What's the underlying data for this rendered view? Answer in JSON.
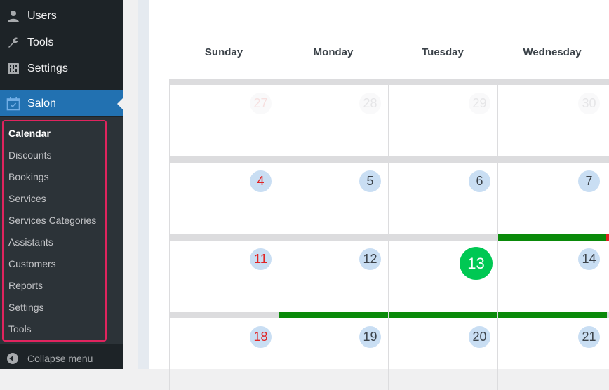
{
  "sidebar": {
    "top_items": [
      {
        "label": "Users",
        "icon": "user-icon"
      },
      {
        "label": "Tools",
        "icon": "wrench-icon"
      },
      {
        "label": "Settings",
        "icon": "settings-sliders-icon"
      }
    ],
    "active_item": {
      "label": "Salon",
      "icon": "calendar-icon"
    },
    "submenu": [
      {
        "label": "Calendar",
        "current": true
      },
      {
        "label": "Discounts"
      },
      {
        "label": "Bookings"
      },
      {
        "label": "Services"
      },
      {
        "label": "Services Categories"
      },
      {
        "label": "Assistants"
      },
      {
        "label": "Customers"
      },
      {
        "label": "Reports"
      },
      {
        "label": "Settings"
      },
      {
        "label": "Tools"
      }
    ],
    "collapse_label": "Collapse menu"
  },
  "calendar": {
    "weekdays": [
      "Sunday",
      "Monday",
      "Tuesday",
      "Wednesday"
    ],
    "weeks": [
      {
        "days": [
          "27",
          "28",
          "29",
          "30"
        ],
        "other_month": true,
        "green_bars": [
          false,
          false,
          false,
          false
        ]
      },
      {
        "days": [
          "4",
          "5",
          "6",
          "7"
        ],
        "other_month": false,
        "green_bars": [
          false,
          false,
          false,
          false
        ]
      },
      {
        "days": [
          "11",
          "12",
          "13",
          "14"
        ],
        "other_month": false,
        "green_bars": [
          false,
          false,
          false,
          true
        ]
      },
      {
        "days": [
          "18",
          "19",
          "20",
          "21"
        ],
        "other_month": false,
        "green_bars": [
          false,
          true,
          true,
          true
        ]
      }
    ],
    "today": "13",
    "colors": {
      "today": "#00c853",
      "sunday_text": "#e02424",
      "busy_bar": "#0a8a0a",
      "accent": "#2271b1",
      "highlight_border": "#e0245e"
    }
  }
}
